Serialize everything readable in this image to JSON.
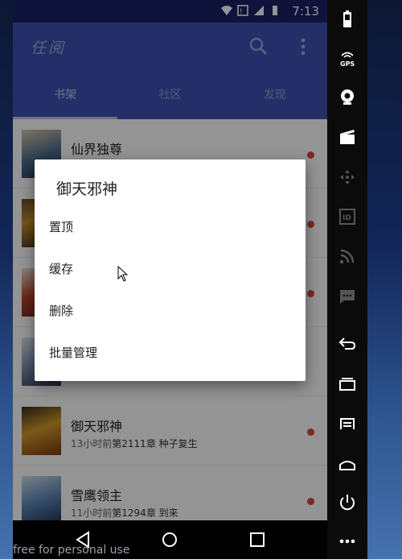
{
  "status_bar": {
    "time": "7:13"
  },
  "app_bar": {
    "title": "任阅"
  },
  "tabs": [
    {
      "label": "书架",
      "active": true
    },
    {
      "label": "社区",
      "active": false
    },
    {
      "label": "发现",
      "active": false
    }
  ],
  "books": [
    {
      "title": "仙界独尊",
      "time": "",
      "chapter": ""
    },
    {
      "title": "",
      "time": "",
      "chapter": ""
    },
    {
      "title": "",
      "time": "",
      "chapter": ""
    },
    {
      "title": "",
      "time": "",
      "chapter": ""
    },
    {
      "title": "御天邪神",
      "time": "13小时前",
      "chapter": "第2111章 种子复生"
    },
    {
      "title": "雪鹰领主",
      "time": "11小时前",
      "chapter": "第1294章 到来"
    }
  ],
  "dialog": {
    "title": "御天邪神",
    "items": [
      "置顶",
      "缓存",
      "删除",
      "批量管理"
    ]
  },
  "watermark": "free for personal use",
  "colors": {
    "primary": "#3f51b5",
    "status_bar": "#1a2267",
    "unread_dot": "#d9463b"
  },
  "icons": {
    "app_bar": [
      "search-icon",
      "more-vert-icon"
    ],
    "nav": [
      "back-icon",
      "home-icon",
      "recents-icon"
    ],
    "emulator_sidebar": [
      "battery-icon",
      "gps-icon",
      "camera-icon",
      "video-icon",
      "dpad-icon",
      "id-icon",
      "rss-icon",
      "message-icon",
      "back-arrow-icon",
      "recent-apps-icon",
      "menu-icon",
      "home-icon",
      "power-icon",
      "more-icon"
    ]
  },
  "sidebar": {
    "gps_label": "GPS",
    "id_label": "ID"
  }
}
